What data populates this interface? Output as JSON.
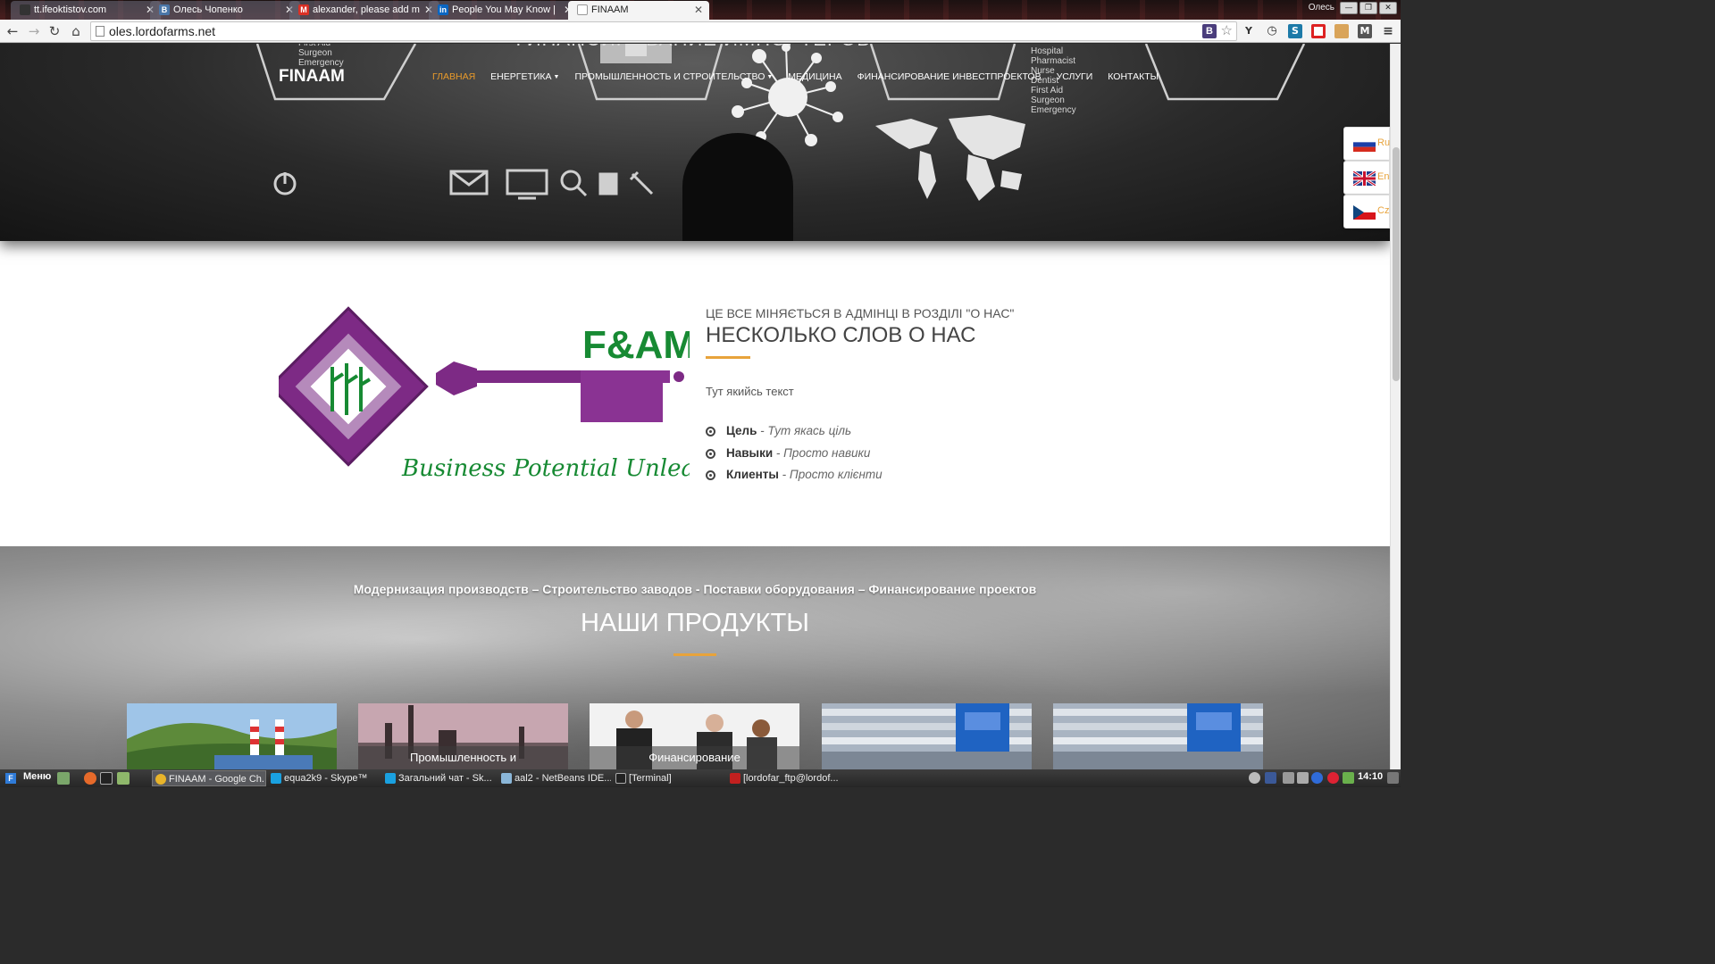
{
  "browser": {
    "tabs": [
      {
        "title": "tt.ifeoktistov.com",
        "icon": "site-icon"
      },
      {
        "title": "Олесь Чопенко",
        "icon": "vk-icon"
      },
      {
        "title": "alexander, please add m",
        "icon": "gmail-icon"
      },
      {
        "title": "People You May Know |",
        "icon": "linkedin-icon"
      },
      {
        "title": "FINAAM",
        "icon": "page-icon"
      }
    ],
    "window_user": "Олесь",
    "url": "oles.lordofarms.net"
  },
  "site": {
    "hero_title": "ФИНАНСИРОВАНИЕ ИМПОРТЕРОВ",
    "hero_list_left": "First Aid\nSurgeon\nEmergency",
    "hero_list_right": "Hospital\nPharmacist\nNurse\nDentist\nFirst Aid\nSurgeon\nEmergency",
    "brand": "FINAAM",
    "menu": [
      {
        "label": "ГЛАВНАЯ",
        "active": true,
        "dropdown": false
      },
      {
        "label": "ЕНЕРГЕТИКА",
        "active": false,
        "dropdown": true
      },
      {
        "label": "ПРОМЫШЛЕННОСТЬ И СТРОИТЕЛЬСТВО",
        "active": false,
        "dropdown": true
      },
      {
        "label": "МЕДИЦИНА",
        "active": false,
        "dropdown": false
      },
      {
        "label": "ФИНАНСИРОВАНИЕ ИНВЕСТПРОЕКТОВ",
        "active": false,
        "dropdown": false
      },
      {
        "label": "УСЛУГИ",
        "active": false,
        "dropdown": false
      },
      {
        "label": "КОНТАКТЫ",
        "active": false,
        "dropdown": false
      }
    ],
    "languages": [
      {
        "label": "Rus",
        "flag": "ru-flag"
      },
      {
        "label": "Eng",
        "flag": "gb-flag"
      },
      {
        "label": "Cze",
        "flag": "cz-flag"
      }
    ],
    "about": {
      "logo_letters": "F&AM",
      "logo_tagline": "Business  Potential  Unleashed",
      "kicker": "ЦЕ ВСЕ МІНЯЄТЬСЯ В АДМІНЦІ В РОЗДІЛІ \"О НАС\"",
      "title": "НЕСКОЛЬКО СЛОВ О НАС",
      "text": "Тут якийсь текст",
      "items": [
        {
          "label": "Цель",
          "text": " - Тут якась ціль"
        },
        {
          "label": "Навыки",
          "text": " - Просто навики"
        },
        {
          "label": "Клиенты",
          "text": " - Просто клієнти"
        }
      ]
    },
    "products": {
      "subtitle": "Модернизация производств – Строительство заводов - Поставки оборудования – Финансирование проектов",
      "title": "НАШИ ПРОДУКТЫ",
      "cards": [
        {
          "caption": "",
          "image": "power-plant"
        },
        {
          "caption": "Промышленность и",
          "image": "refinery"
        },
        {
          "caption": "Финансирование",
          "image": "business-meeting"
        },
        {
          "caption": "",
          "image": "factory-pipes"
        },
        {
          "caption": "",
          "image": "factory-pipes"
        }
      ]
    }
  },
  "taskbar": {
    "menu_label": "Меню",
    "tasks": [
      {
        "label": "FINAAM - Google Ch...",
        "active": true
      },
      {
        "label": "equa2k9 - Skype™",
        "active": false
      },
      {
        "label": "Загальний чат - Sk...",
        "active": false
      },
      {
        "label": "aal2 - NetBeans IDE...",
        "active": false
      },
      {
        "label": "[Terminal]",
        "active": false
      },
      {
        "label": "[lordofar_ftp@lordof...",
        "active": false
      }
    ],
    "time": "14:10"
  },
  "colors": {
    "accent": "#e8a33b",
    "active_menu": "#e89a2a",
    "logo_purple": "#7d2a85",
    "logo_green": "#178a33"
  }
}
